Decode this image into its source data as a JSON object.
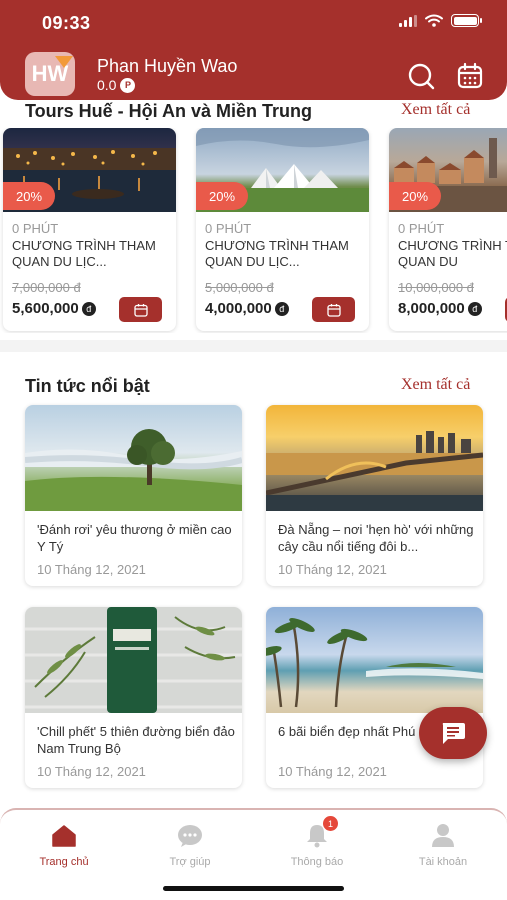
{
  "status_bar": {
    "time": "09:33"
  },
  "user": {
    "initials": "HW",
    "name": "Phan Huyền Wao",
    "points": "0.0",
    "points_unit": "P"
  },
  "tours": {
    "title": "Tours Huế - Hội An và Miền Trung",
    "see_all": "Xem tất cả",
    "items": [
      {
        "discount": "20%",
        "duration": "0 PHÚT",
        "name": "CHƯƠNG TRÌNH THAM QUAN DU LỊC...",
        "old_price": "7,000,000 đ",
        "price": "5,600,000",
        "currency": "đ",
        "image": "hoi-an-night-river"
      },
      {
        "discount": "20%",
        "duration": "0 PHÚT",
        "name": "CHƯƠNG TRÌNH THAM QUAN DU LỊC...",
        "old_price": "5,000,000 đ",
        "price": "4,000,000",
        "currency": "đ",
        "image": "white-domes-landscape"
      },
      {
        "discount": "20%",
        "duration": "0 PHÚT",
        "name": "CHƯƠNG TRÌNH THAM QUAN DU",
        "old_price": "10,000,000 đ",
        "price": "8,000,000",
        "currency": "đ",
        "image": "old-town-rooftops"
      }
    ]
  },
  "news": {
    "title": "Tin tức nổi bật",
    "see_all": "Xem tất cả",
    "items": [
      {
        "title": "'Đánh rơi' yêu thương ở miền cao Y Tý",
        "date": "10 Tháng 12, 2021",
        "image": "misty-hill-tree"
      },
      {
        "title": "Đà Nẵng – nơi 'hẹn hò' với những cây cầu nổi tiếng đôi b...",
        "date": "10 Tháng 12, 2021",
        "image": "dragon-bridge-sunset"
      },
      {
        "title": "'Chill phết' 5 thiên đường biển đảo Nam Trung Bộ",
        "date": "10 Tháng 12, 2021",
        "image": "tea-tree-product"
      },
      {
        "title": "6 bãi biển đẹp nhất Phú",
        "date": "10 Tháng 12, 2021",
        "image": "palm-beach"
      }
    ]
  },
  "bottom_nav": [
    {
      "label": "Trang chủ",
      "icon": "home-icon",
      "active": true
    },
    {
      "label": "Trợ giúp",
      "icon": "chat-bubble-icon",
      "active": false
    },
    {
      "label": "Thông báo",
      "icon": "bell-icon",
      "active": false,
      "badge": "1"
    },
    {
      "label": "Tài khoản",
      "icon": "user-icon",
      "active": false
    }
  ],
  "colors": {
    "primary": "#a5302c",
    "discount": "#e95a4a",
    "badge": "#e5483a"
  }
}
